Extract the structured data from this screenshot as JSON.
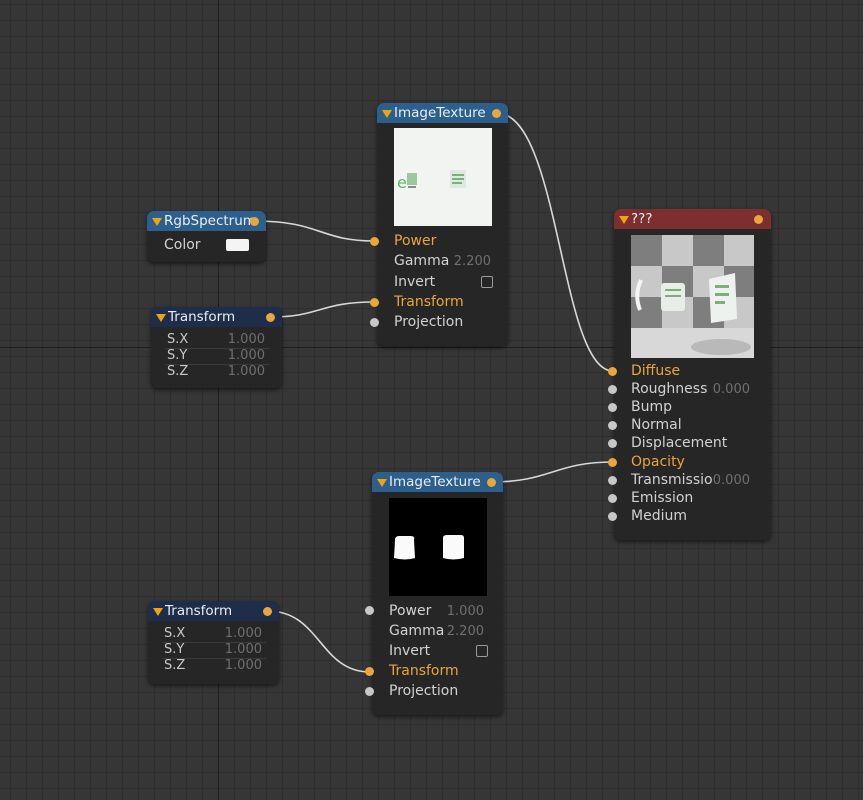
{
  "nodes": {
    "image_texture_1": {
      "title": "ImageTexture",
      "inputs": [
        {
          "label": "Power",
          "value": ""
        },
        {
          "label": "Gamma",
          "value": "2.200"
        },
        {
          "label": "Invert",
          "value": ""
        },
        {
          "label": "Transform",
          "value": ""
        },
        {
          "label": "Projection",
          "value": ""
        }
      ]
    },
    "rgb_spectrum": {
      "title": "RgbSpectrum",
      "color_label": "Color",
      "color_value": "#f4f4f4"
    },
    "transform_1": {
      "title": "Transform",
      "rows": [
        {
          "label": "S.X",
          "value": "1.000"
        },
        {
          "label": "S.Y",
          "value": "1.000"
        },
        {
          "label": "S.Z",
          "value": "1.000"
        }
      ]
    },
    "material": {
      "title": "???",
      "inputs": [
        {
          "label": "Diffuse",
          "value": ""
        },
        {
          "label": "Roughness",
          "value": "0.000"
        },
        {
          "label": "Bump",
          "value": ""
        },
        {
          "label": "Normal",
          "value": ""
        },
        {
          "label": "Displacement",
          "value": ""
        },
        {
          "label": "Opacity",
          "value": ""
        },
        {
          "label": "Transmissio",
          "value": "0.000"
        },
        {
          "label": "Emission",
          "value": ""
        },
        {
          "label": "Medium",
          "value": ""
        }
      ]
    },
    "image_texture_2": {
      "title": "ImageTexture",
      "inputs": [
        {
          "label": "Power",
          "value": "1.000"
        },
        {
          "label": "Gamma",
          "value": "2.200"
        },
        {
          "label": "Invert",
          "value": ""
        },
        {
          "label": "Transform",
          "value": ""
        },
        {
          "label": "Projection",
          "value": ""
        }
      ]
    },
    "transform_2": {
      "title": "Transform",
      "rows": [
        {
          "label": "S.X",
          "value": "1.000"
        },
        {
          "label": "S.Y",
          "value": "1.000"
        },
        {
          "label": "S.Z",
          "value": "1.000"
        }
      ]
    }
  },
  "colors": {
    "accent_pin": "#e9a63b",
    "header_texture": "#2d5f8d",
    "header_transform": "#1e2d4a",
    "header_material": "#7d2e2e",
    "canvas_bg": "#363636"
  }
}
